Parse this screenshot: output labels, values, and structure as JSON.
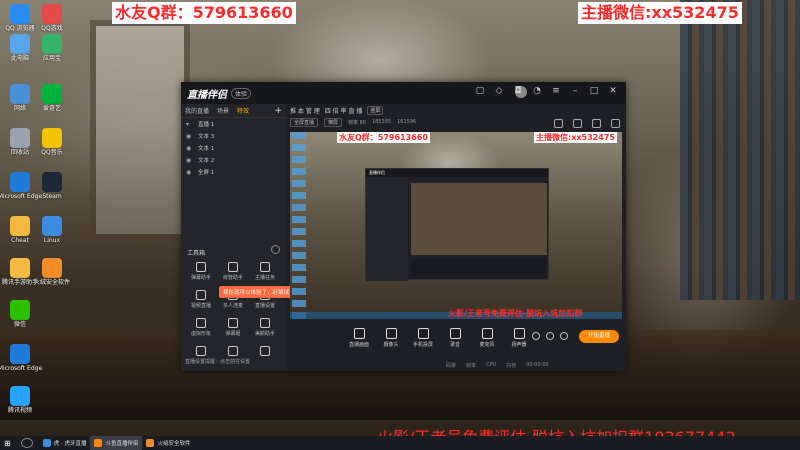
{
  "overlays": {
    "qq_group": "水友Q群：579613660",
    "wechat": "主播微信:xx532475",
    "bottom_banner": "火影/王者号免费评估-脱坑入坑加扣群193677442"
  },
  "desktop_icons": [
    {
      "label": "QQ 浏览器",
      "icon": "browser-icon",
      "color": "#2a8cf0"
    },
    {
      "label": "QQ游戏",
      "icon": "game-icon",
      "color": "#e34b4b"
    },
    {
      "label": "此电脑",
      "icon": "computer-icon",
      "color": "#58a6e8"
    },
    {
      "label": "应用宝",
      "icon": "app-store-icon",
      "color": "#36b26a"
    },
    {
      "label": "网络",
      "icon": "network-icon",
      "color": "#4a90d9"
    },
    {
      "label": "爱奇艺",
      "icon": "video-icon",
      "color": "#00b33c"
    },
    {
      "label": "回收站",
      "icon": "recycle-bin-icon",
      "color": "#9aa4b0"
    },
    {
      "label": "QQ音乐",
      "icon": "music-icon",
      "color": "#f5c400"
    },
    {
      "label": "Microsoft Edge",
      "icon": "ie-icon",
      "color": "#1f7ad9"
    },
    {
      "label": "Steam",
      "icon": "steam-icon",
      "color": "#1b2838"
    },
    {
      "label": "Cheat",
      "icon": "folder-icon",
      "color": "#f4b942"
    },
    {
      "label": "Linux",
      "icon": "app-icon",
      "color": "#3c8de0"
    },
    {
      "label": "腾讯手游助手",
      "icon": "folder-icon",
      "color": "#f4b942"
    },
    {
      "label": "火绒安全软件",
      "icon": "shield-icon",
      "color": "#f28c28"
    },
    {
      "label": "微信",
      "icon": "wechat-icon",
      "color": "#2dc100"
    },
    {
      "label": "Microsoft Edge",
      "icon": "edge-icon",
      "color": "#1f7ad9"
    },
    {
      "label": "腾讯视频",
      "icon": "play-icon",
      "color": "#27a4ff"
    }
  ],
  "app": {
    "logo": "直播伴侣",
    "badge": "体验",
    "left_tabs": [
      "我的直播",
      "场景",
      "特效",
      "+"
    ],
    "active_left_tab": "特效",
    "scene_title": "直播 1",
    "sources": [
      "文本 3",
      "文本 1",
      "文本 2",
      "全屏 1"
    ],
    "tools_title": "工具箱",
    "tools": [
      "弹幕助手",
      "房管助手",
      "主播任务",
      "视频直播",
      "多人连麦",
      "直播设置",
      "虚拟形象",
      "弹幕姬",
      "美颜助手",
      "",
      "",
      ""
    ],
    "tooltip": "现在就可以体验了，赶紧试试吧",
    "main_tabs": [
      "推 本 管 理",
      "四 倍 率 直 播",
      "竖屏"
    ],
    "main_row2": [
      "全屏直播",
      "横屏",
      "分辨率",
      "1920×1080"
    ],
    "stats_left": "帧率 60",
    "stats_mid": "185365",
    "stats_right": "161596",
    "preview_overlays": [
      "水友Q群：579613660",
      "主播微信:xx532475",
      "火影/王者号免费评估-脱坑入坑加扣群193677442"
    ],
    "controls": [
      "直播画面",
      "摄像头",
      "手机投屏",
      "录音",
      "麦克风",
      "扬声器"
    ],
    "start_button": "开始直播",
    "footer": "直播设置提醒：点击前往设置",
    "status": [
      "码率",
      "帧率",
      "CPU",
      "内存",
      "00:00:00"
    ]
  },
  "taskbar": {
    "items": [
      "虎 · 虎牙直播",
      "斗鱼直播伴侣",
      "火绒安全软件"
    ],
    "active": 1
  }
}
